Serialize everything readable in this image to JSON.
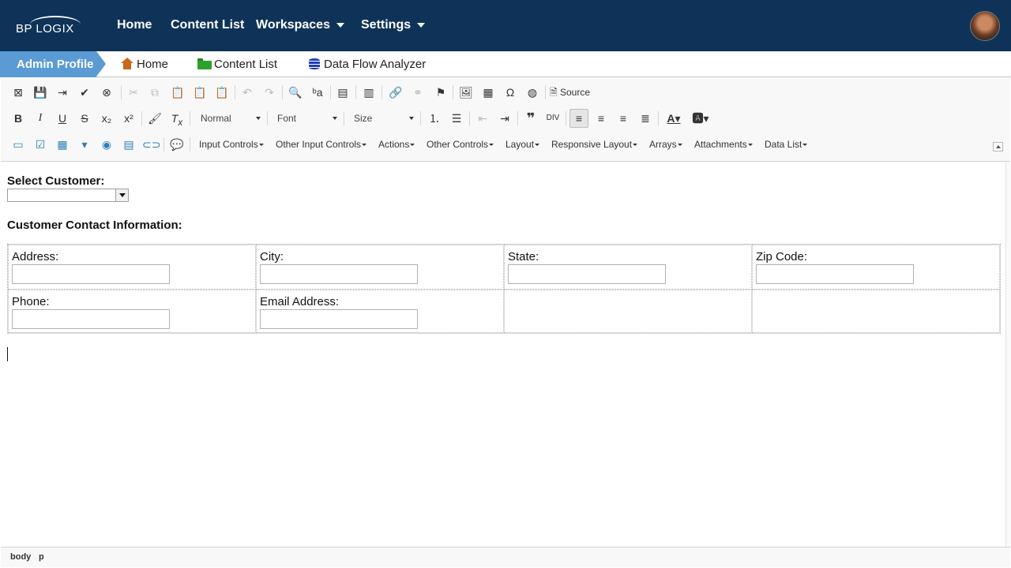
{
  "header": {
    "logo_text": "BP LOGIX",
    "nav": [
      {
        "label": "Home"
      },
      {
        "label": "Content List"
      },
      {
        "label": "Workspaces"
      },
      {
        "label": "Settings"
      }
    ]
  },
  "breadcrumb": {
    "active": "Admin Profile",
    "items": [
      {
        "label": "Home",
        "icon": "home-icon"
      },
      {
        "label": "Content List",
        "icon": "folder-icon"
      },
      {
        "label": "Data Flow Analyzer",
        "icon": "database-icon"
      }
    ]
  },
  "toolbar": {
    "source_label": "Source",
    "format_value": "Normal",
    "font_value": "Font",
    "size_value": "Size",
    "menus": [
      {
        "label": "Input Controls"
      },
      {
        "label": "Other Input Controls"
      },
      {
        "label": "Actions"
      },
      {
        "label": "Other Controls"
      },
      {
        "label": "Layout"
      },
      {
        "label": "Responsive Layout"
      },
      {
        "label": "Arrays"
      },
      {
        "label": "Attachments"
      },
      {
        "label": "Data List"
      }
    ]
  },
  "form": {
    "select_customer_label": "Select Customer:",
    "select_customer_value": "",
    "contact_heading": "Customer Contact Information:",
    "fields": {
      "address": {
        "label": "Address:",
        "value": ""
      },
      "city": {
        "label": "City:",
        "value": ""
      },
      "state": {
        "label": "State:",
        "value": ""
      },
      "zip": {
        "label": "Zip Code:",
        "value": ""
      },
      "phone": {
        "label": "Phone:",
        "value": ""
      },
      "email": {
        "label": "Email Address:",
        "value": ""
      }
    }
  },
  "status": {
    "path": [
      "body",
      "p"
    ]
  }
}
